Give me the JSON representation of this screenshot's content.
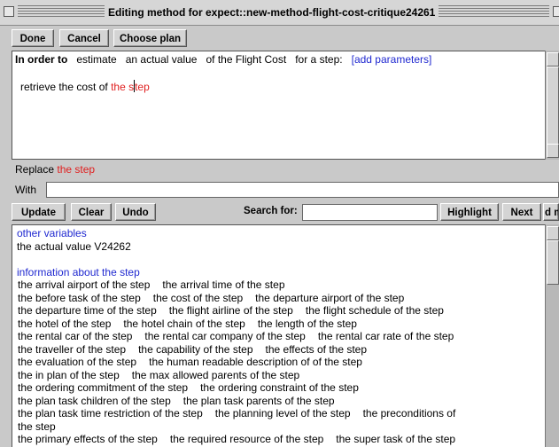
{
  "window": {
    "title": "Editing method for expect::new-method-flight-cost-critique24261"
  },
  "toolbar": {
    "done": "Done",
    "cancel": "Cancel",
    "choose_plan": "Choose plan"
  },
  "method": {
    "in_order_to": "In order to",
    "verb": "estimate",
    "object": "an actual value",
    "of_clause": "of the Flight Cost",
    "for_clause": "for a step:",
    "add_params": "[add parameters]",
    "body_prefix": "retrieve  the cost of",
    "body_var_a": "the s",
    "body_var_b": "tep"
  },
  "replace": {
    "label": "Replace",
    "value": "the step",
    "with_label": "With",
    "with_value": ""
  },
  "actions": {
    "update": "Update",
    "clear": "Clear",
    "undo": "Undo",
    "search_label": "Search for:",
    "search_value": "",
    "highlight": "Highlight",
    "next": "Next",
    "find_partial": "d m"
  },
  "vars": {
    "other_header": "other variables",
    "other_value": "the actual value V24262",
    "info_header": "information about the step",
    "rows": [
      [
        "the arrival airport of the step",
        "the arrival time of the step"
      ],
      [
        "the before task of the step",
        "the cost of the step",
        "the departure airport of the step"
      ],
      [
        "the departure time of the step",
        "the flight airline of the step",
        "the flight schedule of the step"
      ],
      [
        "the hotel of the step",
        "the hotel chain of the step",
        "the length of the step"
      ],
      [
        "the rental car of the step",
        "the rental car company of the step",
        "the rental car rate of the step"
      ],
      [
        "the traveller of the step",
        "the capability of the step",
        "the effects of the step"
      ],
      [
        "the evaluation of the step",
        "the human readable description of of the step"
      ],
      [
        "the in plan of the step",
        "the max allowed parents of the step"
      ],
      [
        "the ordering commitment of the step",
        "the ordering constraint of the step"
      ],
      [
        "the plan task children of the step",
        "the plan task parents of the step"
      ],
      [
        "the plan task time restriction of the step",
        "the planning level of the step",
        "the preconditions of"
      ],
      [
        "the step"
      ],
      [
        "the primary effects of the step",
        "the required resource of the step",
        "the super task of the step"
      ]
    ]
  }
}
